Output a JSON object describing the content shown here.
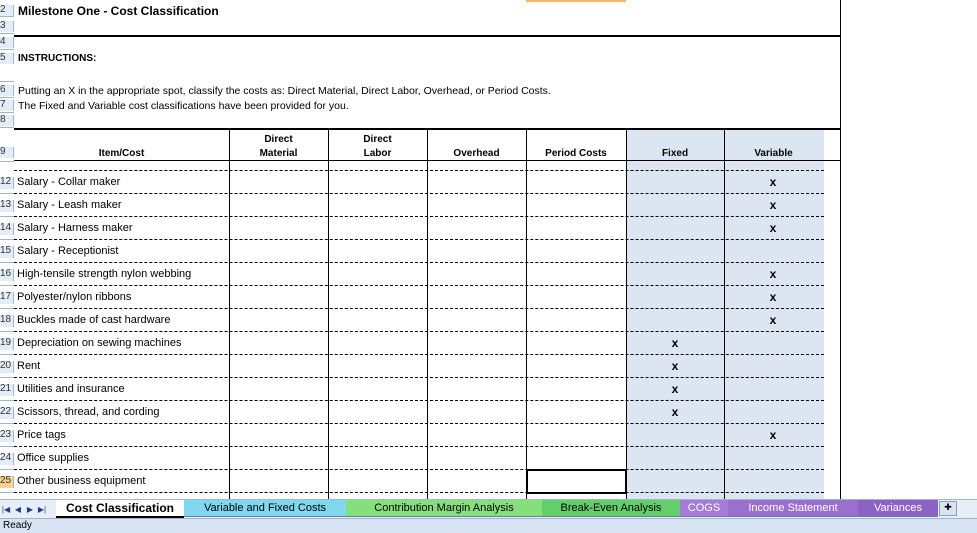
{
  "sheet": {
    "title": "Milestone One - Cost Classification",
    "instructions_heading": "INSTRUCTIONS:",
    "instruction_lines": [
      "Putting an X in the appropriate spot, classify the costs as:  Direct Material, Direct Labor, Overhead, or Period Costs.",
      "The Fixed and Variable cost classifications have been provided for you."
    ],
    "header_row_numbers": [
      "2",
      "3",
      "4",
      "5",
      "6",
      "7",
      "8",
      "9"
    ],
    "columns": [
      {
        "key": "item",
        "label": "Item/Cost"
      },
      {
        "key": "dm",
        "label": "Direct\nMaterial"
      },
      {
        "key": "dl",
        "label": "Direct\nLabor"
      },
      {
        "key": "oh",
        "label": "Overhead"
      },
      {
        "key": "pc",
        "label": "Period Costs"
      },
      {
        "key": "fixed",
        "label": "Fixed"
      },
      {
        "key": "variable",
        "label": "Variable"
      }
    ],
    "rows": [
      {
        "num": "12",
        "item": "Salary - Collar maker",
        "fixed": "",
        "variable": "x"
      },
      {
        "num": "13",
        "item": "Salary - Leash maker",
        "fixed": "",
        "variable": "x"
      },
      {
        "num": "14",
        "item": "Salary - Harness maker",
        "fixed": "",
        "variable": "x"
      },
      {
        "num": "15",
        "item": "Salary - Receptionist",
        "fixed": "",
        "variable": ""
      },
      {
        "num": "16",
        "item": "High-tensile strength nylon webbing",
        "fixed": "",
        "variable": "x"
      },
      {
        "num": "17",
        "item": "Polyester/nylon ribbons",
        "fixed": "",
        "variable": "x"
      },
      {
        "num": "18",
        "item": "Buckles made of cast hardware",
        "fixed": "",
        "variable": "x"
      },
      {
        "num": "19",
        "item": "Depreciation on sewing machines",
        "fixed": "x",
        "variable": ""
      },
      {
        "num": "20",
        "item": "Rent",
        "fixed": "x",
        "variable": ""
      },
      {
        "num": "21",
        "item": "Utilities and insurance",
        "fixed": "x",
        "variable": ""
      },
      {
        "num": "22",
        "item": "Scissors, thread, and cording",
        "fixed": "x",
        "variable": ""
      },
      {
        "num": "23",
        "item": "Price tags",
        "fixed": "",
        "variable": "x"
      },
      {
        "num": "24",
        "item": "Office supplies",
        "fixed": "",
        "variable": ""
      },
      {
        "num": "25",
        "item": "Other business equipment",
        "fixed": "",
        "variable": ""
      }
    ],
    "selected_row": "25"
  },
  "tabs": {
    "nav": [
      "first-sheet",
      "previous-sheet",
      "next-sheet",
      "last-sheet"
    ],
    "items": [
      {
        "label": "Cost Classification",
        "style": "active"
      },
      {
        "label": "Variable and Fixed Costs",
        "style": "blue"
      },
      {
        "label": "Contribution Margin Analysis",
        "style": "green"
      },
      {
        "label": "Break-Even Analysis",
        "style": "green2"
      },
      {
        "label": "COGS",
        "style": "purple"
      },
      {
        "label": "Income Statement",
        "style": "purple2"
      },
      {
        "label": "Variances",
        "style": "purple3"
      }
    ]
  },
  "status": {
    "text": "Ready"
  }
}
